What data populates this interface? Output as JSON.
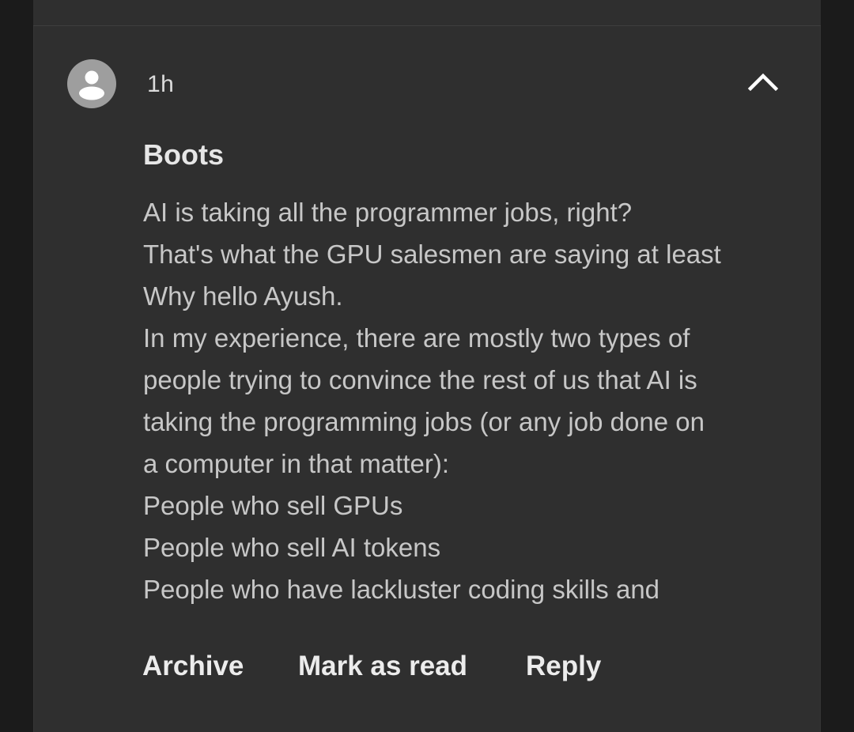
{
  "notification": {
    "time": "1h",
    "sender": "Boots",
    "body_lines": [
      "AI is taking all the programmer jobs, right?",
      "That's what the GPU salesmen are saying at least",
      "Why hello Ayush.",
      "In my experience, there are mostly two types of",
      "people trying to convince the rest of us that AI is",
      "taking the programming jobs (or any job done on",
      "a computer in that matter):",
      "People who sell GPUs",
      "People who sell AI tokens",
      "People who have lackluster coding skills and"
    ],
    "actions": {
      "archive": "Archive",
      "mark_as_read": "Mark as read",
      "reply": "Reply"
    },
    "icons": {
      "avatar": "person-icon",
      "collapse": "chevron-up-icon"
    },
    "colors": {
      "background": "#1b1b1b",
      "card": "#2f2f2f",
      "avatar": "#9e9e9e",
      "text_primary": "#e6e6e6",
      "text_body": "#c7c7c7"
    }
  }
}
